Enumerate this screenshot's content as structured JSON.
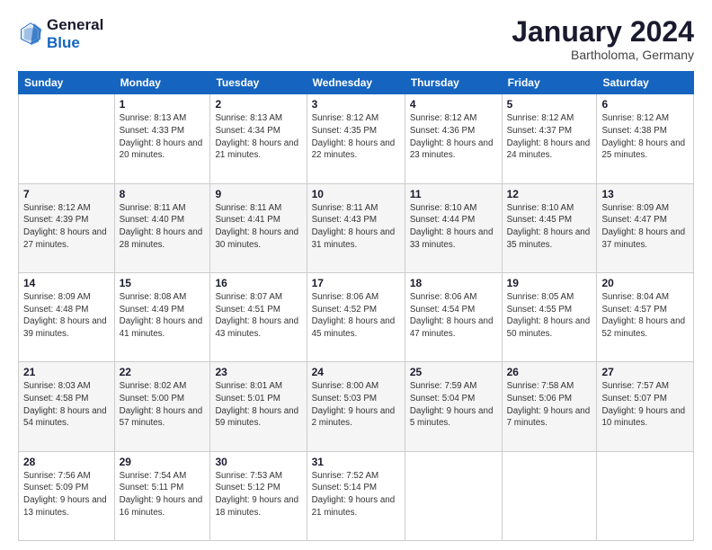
{
  "logo": {
    "line1": "General",
    "line2": "Blue"
  },
  "header": {
    "title": "January 2024",
    "subtitle": "Bartholoma, Germany"
  },
  "days_of_week": [
    "Sunday",
    "Monday",
    "Tuesday",
    "Wednesday",
    "Thursday",
    "Friday",
    "Saturday"
  ],
  "weeks": [
    [
      {
        "day": "",
        "sunrise": "",
        "sunset": "",
        "daylight": ""
      },
      {
        "day": "1",
        "sunrise": "Sunrise: 8:13 AM",
        "sunset": "Sunset: 4:33 PM",
        "daylight": "Daylight: 8 hours and 20 minutes."
      },
      {
        "day": "2",
        "sunrise": "Sunrise: 8:13 AM",
        "sunset": "Sunset: 4:34 PM",
        "daylight": "Daylight: 8 hours and 21 minutes."
      },
      {
        "day": "3",
        "sunrise": "Sunrise: 8:12 AM",
        "sunset": "Sunset: 4:35 PM",
        "daylight": "Daylight: 8 hours and 22 minutes."
      },
      {
        "day": "4",
        "sunrise": "Sunrise: 8:12 AM",
        "sunset": "Sunset: 4:36 PM",
        "daylight": "Daylight: 8 hours and 23 minutes."
      },
      {
        "day": "5",
        "sunrise": "Sunrise: 8:12 AM",
        "sunset": "Sunset: 4:37 PM",
        "daylight": "Daylight: 8 hours and 24 minutes."
      },
      {
        "day": "6",
        "sunrise": "Sunrise: 8:12 AM",
        "sunset": "Sunset: 4:38 PM",
        "daylight": "Daylight: 8 hours and 25 minutes."
      }
    ],
    [
      {
        "day": "7",
        "sunrise": "Sunrise: 8:12 AM",
        "sunset": "Sunset: 4:39 PM",
        "daylight": "Daylight: 8 hours and 27 minutes."
      },
      {
        "day": "8",
        "sunrise": "Sunrise: 8:11 AM",
        "sunset": "Sunset: 4:40 PM",
        "daylight": "Daylight: 8 hours and 28 minutes."
      },
      {
        "day": "9",
        "sunrise": "Sunrise: 8:11 AM",
        "sunset": "Sunset: 4:41 PM",
        "daylight": "Daylight: 8 hours and 30 minutes."
      },
      {
        "day": "10",
        "sunrise": "Sunrise: 8:11 AM",
        "sunset": "Sunset: 4:43 PM",
        "daylight": "Daylight: 8 hours and 31 minutes."
      },
      {
        "day": "11",
        "sunrise": "Sunrise: 8:10 AM",
        "sunset": "Sunset: 4:44 PM",
        "daylight": "Daylight: 8 hours and 33 minutes."
      },
      {
        "day": "12",
        "sunrise": "Sunrise: 8:10 AM",
        "sunset": "Sunset: 4:45 PM",
        "daylight": "Daylight: 8 hours and 35 minutes."
      },
      {
        "day": "13",
        "sunrise": "Sunrise: 8:09 AM",
        "sunset": "Sunset: 4:47 PM",
        "daylight": "Daylight: 8 hours and 37 minutes."
      }
    ],
    [
      {
        "day": "14",
        "sunrise": "Sunrise: 8:09 AM",
        "sunset": "Sunset: 4:48 PM",
        "daylight": "Daylight: 8 hours and 39 minutes."
      },
      {
        "day": "15",
        "sunrise": "Sunrise: 8:08 AM",
        "sunset": "Sunset: 4:49 PM",
        "daylight": "Daylight: 8 hours and 41 minutes."
      },
      {
        "day": "16",
        "sunrise": "Sunrise: 8:07 AM",
        "sunset": "Sunset: 4:51 PM",
        "daylight": "Daylight: 8 hours and 43 minutes."
      },
      {
        "day": "17",
        "sunrise": "Sunrise: 8:06 AM",
        "sunset": "Sunset: 4:52 PM",
        "daylight": "Daylight: 8 hours and 45 minutes."
      },
      {
        "day": "18",
        "sunrise": "Sunrise: 8:06 AM",
        "sunset": "Sunset: 4:54 PM",
        "daylight": "Daylight: 8 hours and 47 minutes."
      },
      {
        "day": "19",
        "sunrise": "Sunrise: 8:05 AM",
        "sunset": "Sunset: 4:55 PM",
        "daylight": "Daylight: 8 hours and 50 minutes."
      },
      {
        "day": "20",
        "sunrise": "Sunrise: 8:04 AM",
        "sunset": "Sunset: 4:57 PM",
        "daylight": "Daylight: 8 hours and 52 minutes."
      }
    ],
    [
      {
        "day": "21",
        "sunrise": "Sunrise: 8:03 AM",
        "sunset": "Sunset: 4:58 PM",
        "daylight": "Daylight: 8 hours and 54 minutes."
      },
      {
        "day": "22",
        "sunrise": "Sunrise: 8:02 AM",
        "sunset": "Sunset: 5:00 PM",
        "daylight": "Daylight: 8 hours and 57 minutes."
      },
      {
        "day": "23",
        "sunrise": "Sunrise: 8:01 AM",
        "sunset": "Sunset: 5:01 PM",
        "daylight": "Daylight: 8 hours and 59 minutes."
      },
      {
        "day": "24",
        "sunrise": "Sunrise: 8:00 AM",
        "sunset": "Sunset: 5:03 PM",
        "daylight": "Daylight: 9 hours and 2 minutes."
      },
      {
        "day": "25",
        "sunrise": "Sunrise: 7:59 AM",
        "sunset": "Sunset: 5:04 PM",
        "daylight": "Daylight: 9 hours and 5 minutes."
      },
      {
        "day": "26",
        "sunrise": "Sunrise: 7:58 AM",
        "sunset": "Sunset: 5:06 PM",
        "daylight": "Daylight: 9 hours and 7 minutes."
      },
      {
        "day": "27",
        "sunrise": "Sunrise: 7:57 AM",
        "sunset": "Sunset: 5:07 PM",
        "daylight": "Daylight: 9 hours and 10 minutes."
      }
    ],
    [
      {
        "day": "28",
        "sunrise": "Sunrise: 7:56 AM",
        "sunset": "Sunset: 5:09 PM",
        "daylight": "Daylight: 9 hours and 13 minutes."
      },
      {
        "day": "29",
        "sunrise": "Sunrise: 7:54 AM",
        "sunset": "Sunset: 5:11 PM",
        "daylight": "Daylight: 9 hours and 16 minutes."
      },
      {
        "day": "30",
        "sunrise": "Sunrise: 7:53 AM",
        "sunset": "Sunset: 5:12 PM",
        "daylight": "Daylight: 9 hours and 18 minutes."
      },
      {
        "day": "31",
        "sunrise": "Sunrise: 7:52 AM",
        "sunset": "Sunset: 5:14 PM",
        "daylight": "Daylight: 9 hours and 21 minutes."
      },
      {
        "day": "",
        "sunrise": "",
        "sunset": "",
        "daylight": ""
      },
      {
        "day": "",
        "sunrise": "",
        "sunset": "",
        "daylight": ""
      },
      {
        "day": "",
        "sunrise": "",
        "sunset": "",
        "daylight": ""
      }
    ]
  ]
}
